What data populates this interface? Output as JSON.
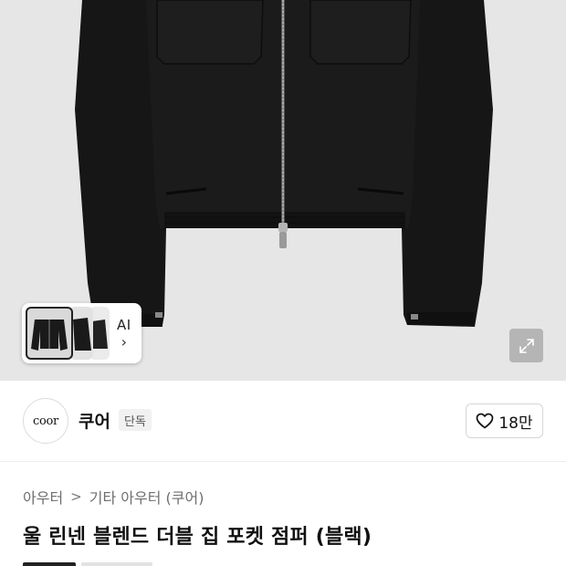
{
  "hero": {
    "ai_label": "AI",
    "ai_chevron": "›"
  },
  "brand": {
    "logo_text": "coor",
    "name": "쿠어",
    "badge": "단독",
    "like_count": "18만"
  },
  "breadcrumb": {
    "items": [
      "아우터",
      "기타 아우터 (쿠어)"
    ],
    "separator": ">"
  },
  "product": {
    "title": "울 린넨 블렌드 더블 집 포켓 점퍼 (블랙)"
  },
  "icons": {
    "expand": "expand-icon",
    "heart": "heart-outline-icon",
    "chevron": "chevron-right-icon"
  },
  "colors": {
    "jacket": "#161616",
    "hero_bg": "#e6e6e6",
    "text_primary": "#111111",
    "text_muted": "#7a7a7a"
  }
}
